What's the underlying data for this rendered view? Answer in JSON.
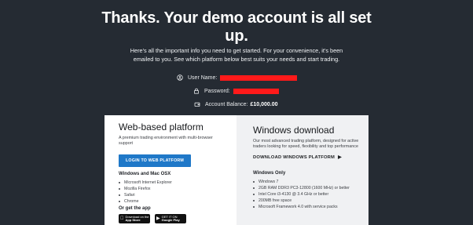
{
  "hero": {
    "title_line1": "Thanks. Your demo account is all set",
    "title_line2": "up.",
    "subtitle_line1": "Here's all the important info you need to get started. For your convenience, it's been",
    "subtitle_line2": "emailed to you. See which platform below best suits your needs and start trading."
  },
  "account": {
    "username_label": "User Name:",
    "password_label": "Password:",
    "balance_label": "Account Balance:",
    "balance_value": "£10,000.00"
  },
  "icons": {
    "user": "user-circle-icon",
    "lock": "lock-icon",
    "wallet": "wallet-icon"
  },
  "colors": {
    "background": "#252b33",
    "redaction": "#ff1a1a",
    "button": "#1f78c8"
  },
  "web": {
    "title": "Web-based platform",
    "desc": "A premium trading environment with multi-browser support",
    "button_label": "LOGIN TO WEB PLATFORM",
    "section_heading": "Windows and Mac OSX",
    "browsers": [
      "Microsoft Internet Explorer",
      "Mozilla Firefox",
      "Safari",
      "Chrome"
    ],
    "app_heading": "Or get the app",
    "app_store_small": "Download on the",
    "app_store_big": "App Store",
    "play_small": "GET IT ON",
    "play_big": "Google Play"
  },
  "windows": {
    "title": "Windows download",
    "desc": "Our most advanced trading platform, designed for active traders looking for speed, flexibility and top performance",
    "download_link": "DOWNLOAD WINDOWS PLATFORM",
    "section_heading": "Windows Only",
    "requirements": [
      "Windows 7",
      "2GB RAM DDR3 PC3-12800 (1600 MHz) or better",
      "Intel Core i3-4130 @ 3.4 GHz or better",
      "200MB free space",
      "Microsoft Framework 4.0 with service packs"
    ]
  }
}
